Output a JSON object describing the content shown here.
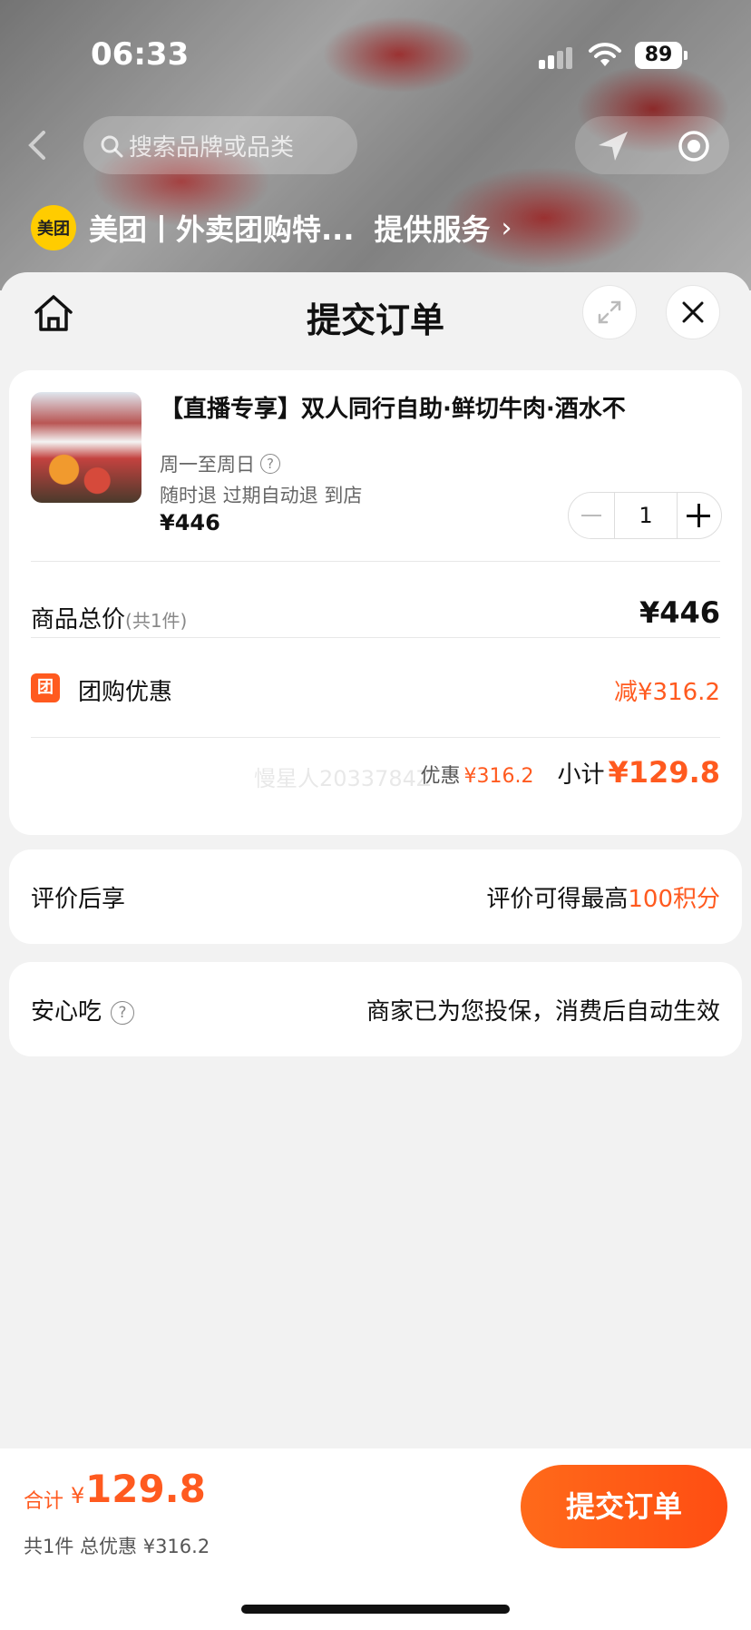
{
  "status_bar": {
    "time": "06:33",
    "battery": "89"
  },
  "top_nav": {
    "search_placeholder": "搜索品牌或品类"
  },
  "brand": {
    "logo_text": "美团",
    "name": "美团丨外卖团购特...",
    "service": "提供服务",
    "chevron": "›"
  },
  "sheet": {
    "title": "提交订单"
  },
  "product": {
    "title": "【直播专享】双人同行自助·鲜切牛肉·酒水不",
    "days": "周一至周日",
    "tags": "随时退 过期自动退 到店",
    "price": "¥446",
    "quantity": "1"
  },
  "summary": {
    "total_label": "商品总价",
    "total_count": "(共1件)",
    "total_value": "¥446",
    "group_icon": "团",
    "group_label": "团购优惠",
    "group_value": "减¥316.2",
    "watermark": "慢星人2033784Z",
    "discount_label": "优惠",
    "discount_value": "¥316.2",
    "subtotal_label": "小计",
    "subtotal_value": "¥129.8"
  },
  "review": {
    "label": "评价后享",
    "value_prefix": "评价可得最高",
    "value_highlight": "100积分"
  },
  "safe": {
    "label": "安心吃",
    "value": "商家已为您投保，消费后自动生效"
  },
  "footer": {
    "total_label": "合计",
    "currency": "¥",
    "total_value": "129.8",
    "summary": "共1件 总优惠 ¥316.2",
    "submit_label": "提交订单"
  },
  "colors": {
    "accent": "#ff5a1f",
    "brand_yellow": "#ffcc00"
  }
}
